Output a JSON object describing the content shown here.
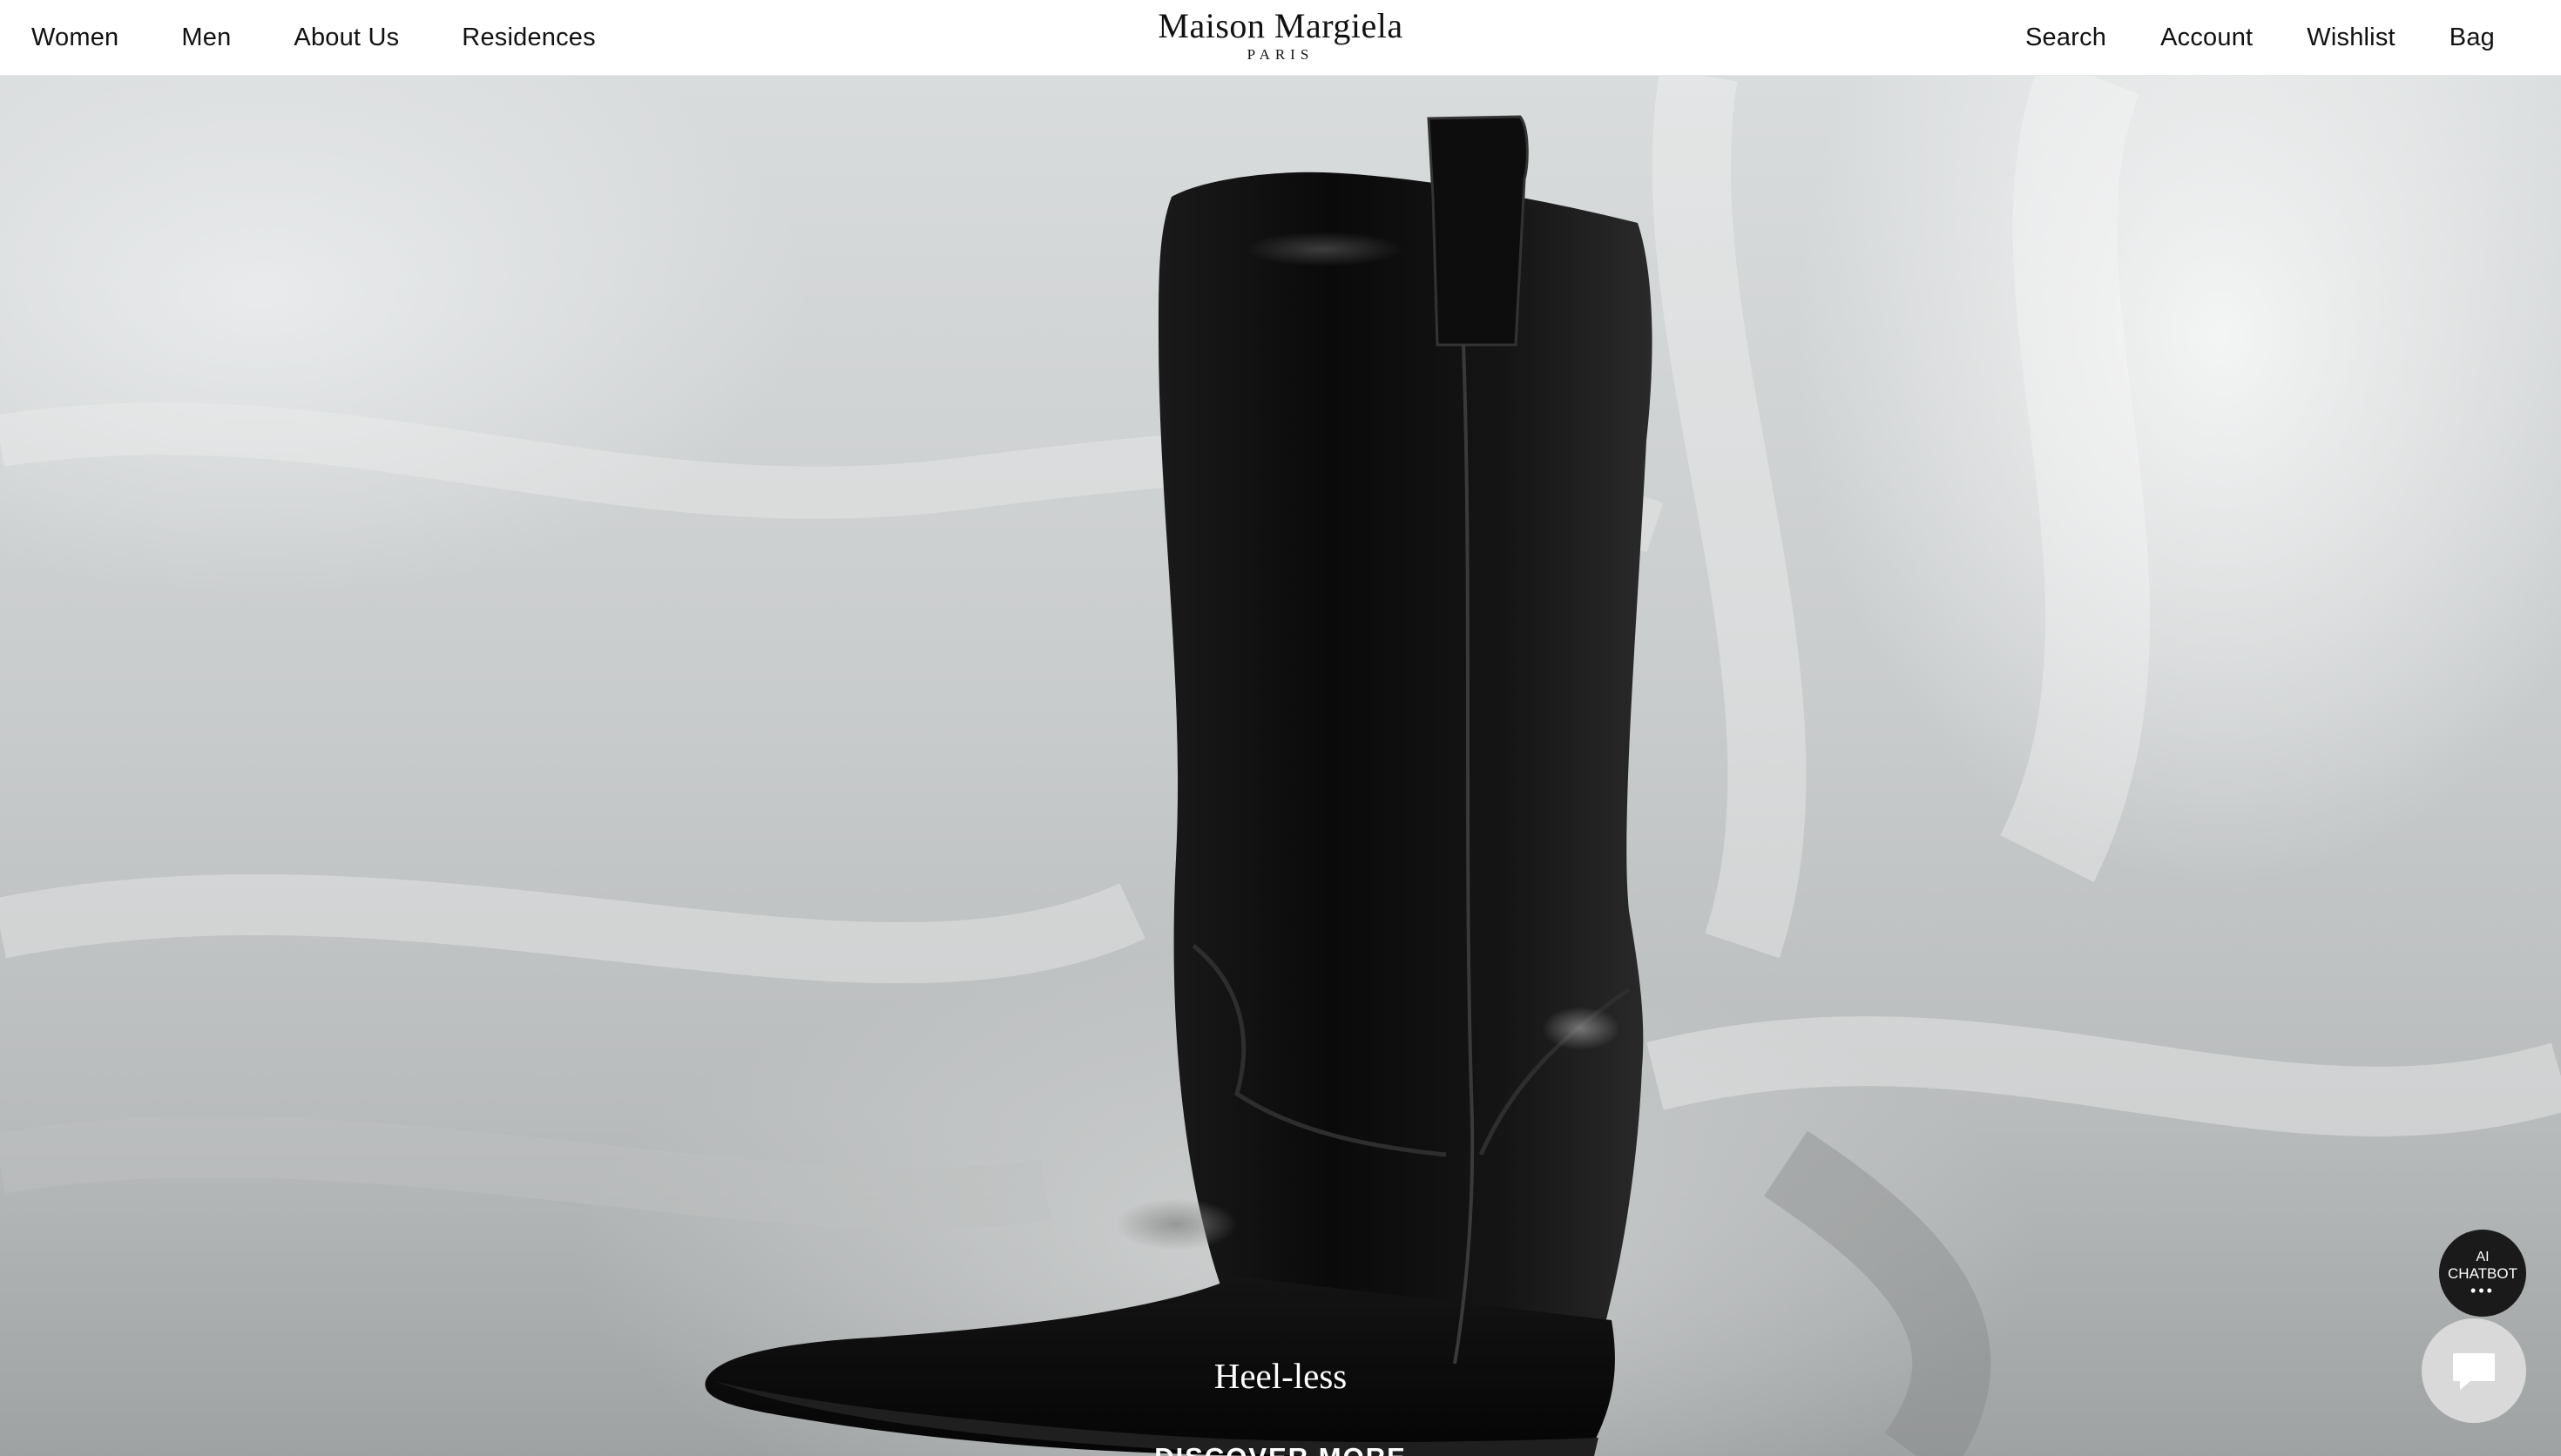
{
  "header": {
    "nav_left": [
      {
        "label": "Women"
      },
      {
        "label": "Men"
      },
      {
        "label": "About Us"
      },
      {
        "label": "Residences"
      }
    ],
    "logo": {
      "name": "Maison Margiela",
      "city": "PARIS"
    },
    "nav_right": [
      {
        "label": "Search"
      },
      {
        "label": "Account"
      },
      {
        "label": "Wishlist"
      },
      {
        "label": "Bag"
      }
    ]
  },
  "hero": {
    "image_icon": "boot-image",
    "caption": "Heel-less",
    "cta": "DISCOVER MORE"
  },
  "chatbot": {
    "line1": "AI",
    "line2": "CHATBOT",
    "dots": "•••",
    "chat_icon": "chat-bubble-icon"
  },
  "colors": {
    "header_bg": "#ffffff",
    "text": "#111111",
    "chatbot_bg": "#1a1a1a",
    "chat_button_bg": "#d9d9d9"
  }
}
